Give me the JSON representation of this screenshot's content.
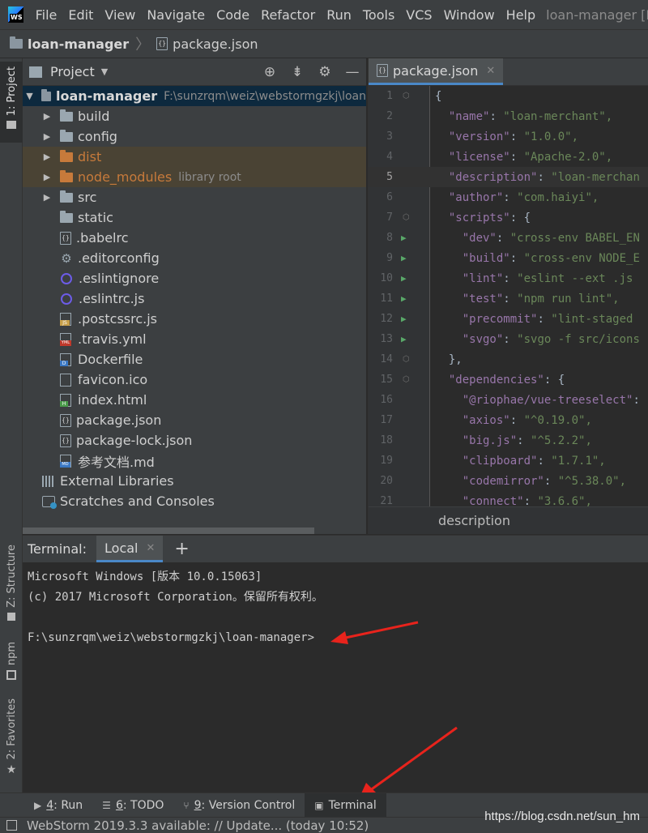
{
  "menubar": {
    "logo_text": "WS",
    "items": [
      "File",
      "Edit",
      "View",
      "Navigate",
      "Code",
      "Refactor",
      "Run",
      "Tools",
      "VCS",
      "Window",
      "Help"
    ],
    "window_title": "loan-manager [F:\\su"
  },
  "breadcrumb": {
    "project": "loan-manager",
    "file": "package.json"
  },
  "left_strip": {
    "project": "1: Project",
    "structure": "Z: Structure",
    "npm": "npm",
    "favorites": "2: Favorites"
  },
  "project_panel": {
    "title": "Project",
    "root": {
      "name": "loan-manager",
      "path": "F:\\sunzrqm\\weiz\\webstormgzkj\\loan"
    },
    "items": [
      {
        "name": "build",
        "kind": "folder"
      },
      {
        "name": "config",
        "kind": "folder"
      },
      {
        "name": "dist",
        "kind": "folder-excluded"
      },
      {
        "name": "node_modules",
        "hint": "library root",
        "kind": "folder-excluded"
      },
      {
        "name": "src",
        "kind": "folder"
      },
      {
        "name": "static",
        "kind": "folder-noarrow"
      },
      {
        "name": ".babelrc",
        "kind": "json"
      },
      {
        "name": ".editorconfig",
        "kind": "gear"
      },
      {
        "name": ".eslintignore",
        "kind": "eslint"
      },
      {
        "name": ".eslintrc.js",
        "kind": "eslint"
      },
      {
        "name": ".postcssrc.js",
        "kind": "js"
      },
      {
        "name": ".travis.yml",
        "kind": "yml"
      },
      {
        "name": "Dockerfile",
        "kind": "d"
      },
      {
        "name": "favicon.ico",
        "kind": "file"
      },
      {
        "name": "index.html",
        "kind": "h"
      },
      {
        "name": "package.json",
        "kind": "json"
      },
      {
        "name": "package-lock.json",
        "kind": "json"
      },
      {
        "name": "参考文档.md",
        "kind": "md"
      }
    ],
    "external_libraries": "External Libraries",
    "scratches": "Scratches and Consoles"
  },
  "editor": {
    "tab": "package.json",
    "breadcrumb": "description",
    "lines": [
      {
        "n": "1",
        "html": "{",
        "fold": true
      },
      {
        "n": "2",
        "key": "\"name\"",
        "val": "\"loan-merchant\","
      },
      {
        "n": "3",
        "key": "\"version\"",
        "val": "\"1.0.0\","
      },
      {
        "n": "4",
        "key": "\"license\"",
        "val": "\"Apache-2.0\","
      },
      {
        "n": "5",
        "key": "\"description\"",
        "val": "\"loan-merchan",
        "current": true
      },
      {
        "n": "6",
        "key": "\"author\"",
        "val": "\"com.haiyi\","
      },
      {
        "n": "7",
        "key": "\"scripts\"",
        "val": "{",
        "fold": true
      },
      {
        "n": "8",
        "key": "\"dev\"",
        "val": "\"cross-env BABEL_EN",
        "run": true,
        "indent": 2
      },
      {
        "n": "9",
        "key": "\"build\"",
        "val": "\"cross-env NODE_E",
        "run": true,
        "indent": 2
      },
      {
        "n": "10",
        "key": "\"lint\"",
        "val": "\"eslint --ext .js",
        "run": true,
        "indent": 2
      },
      {
        "n": "11",
        "key": "\"test\"",
        "val": "\"npm run lint\",",
        "run": true,
        "indent": 2
      },
      {
        "n": "12",
        "key": "\"precommit\"",
        "val": "\"lint-staged",
        "run": true,
        "indent": 2
      },
      {
        "n": "13",
        "key": "\"svgo\"",
        "val": "\"svgo -f src/icons",
        "run": true,
        "indent": 2
      },
      {
        "n": "14",
        "html": "},",
        "fold": true,
        "indent": 1
      },
      {
        "n": "15",
        "key": "\"dependencies\"",
        "val": "{",
        "fold": true
      },
      {
        "n": "16",
        "key": "\"@riophae/vue-treeselect\"",
        "val": "",
        "indent": 2
      },
      {
        "n": "17",
        "key": "\"axios\"",
        "val": "\"^0.19.0\",",
        "indent": 2
      },
      {
        "n": "18",
        "key": "\"big.js\"",
        "val": "\"^5.2.2\",",
        "indent": 2
      },
      {
        "n": "19",
        "key": "\"clipboard\"",
        "val": "\"1.7.1\",",
        "indent": 2
      },
      {
        "n": "20",
        "key": "\"codemirror\"",
        "val": "\"^5.38.0\",",
        "indent": 2
      },
      {
        "n": "21",
        "key": "\"connect\"",
        "val": "\"3.6.6\",",
        "indent": 2
      }
    ]
  },
  "terminal": {
    "label": "Terminal:",
    "tab": "Local",
    "add": "+",
    "output": [
      "Microsoft Windows [版本 10.0.15063]",
      "(c) 2017 Microsoft Corporation。保留所有权利。",
      "",
      "F:\\sunzrqm\\weiz\\webstormgzkj\\loan-manager>"
    ]
  },
  "tool_tabs": [
    {
      "num": "4",
      "label": ": Run",
      "icon": "run-icon"
    },
    {
      "num": "6",
      "label": ": TODO",
      "icon": "todo-icon"
    },
    {
      "num": "9",
      "label": ": Version Control",
      "icon": "vcs-icon"
    },
    {
      "num": "",
      "label": "Terminal",
      "icon": "terminal-icon",
      "active": true
    }
  ],
  "status": {
    "text": "WebStorm 2019.3.3 available: // Update... (today 10:52)",
    "watermark": "https://blog.csdn.net/sun_hm"
  },
  "colors": {
    "accent": "#4a88c7",
    "annotation_arrow": "#e8231c",
    "json_key": "#9876aa",
    "json_string": "#6a8759",
    "excluded_folder": "#c77a3b"
  }
}
